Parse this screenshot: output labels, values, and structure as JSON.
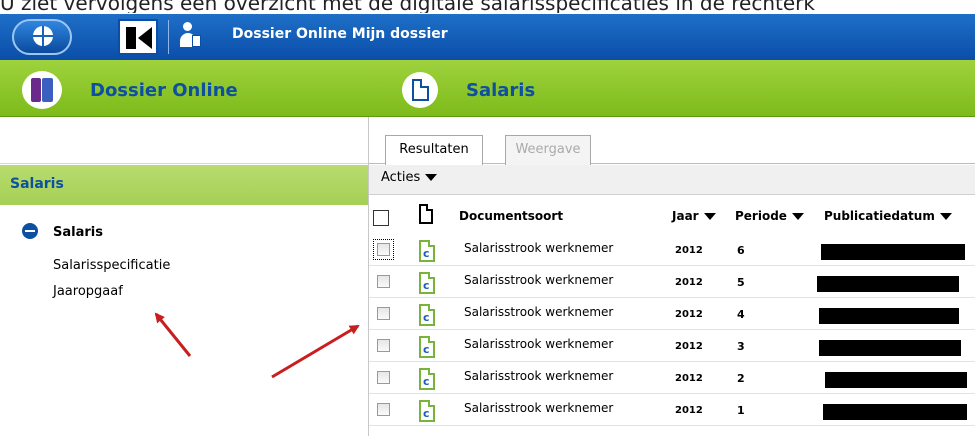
{
  "caption": "U ziet vervolgens een overzicht met de digitale salarisspecificaties in de rechterk",
  "titlebar": {
    "title": "Dossier Online Mijn dossier"
  },
  "header": {
    "app_title": "Dossier Online",
    "section_title": "Salaris"
  },
  "sidebar": {
    "heading": "Salaris",
    "tree_root": "Salaris",
    "items": [
      "Salarisspecificatie",
      "Jaaropgaaf"
    ]
  },
  "tabs": [
    {
      "label": "Resultaten",
      "active": true
    },
    {
      "label": "Weergave",
      "active": false
    }
  ],
  "actions_label": "Acties",
  "table": {
    "columns": [
      "Documentsoort",
      "Jaar",
      "Periode",
      "Publicatiedatum"
    ],
    "doc_icon_letter": "c",
    "rows": [
      {
        "soort": "Salarisstrook werknemer",
        "jaar": "2012",
        "periode": "6"
      },
      {
        "soort": "Salarisstrook werknemer",
        "jaar": "2012",
        "periode": "5"
      },
      {
        "soort": "Salarisstrook werknemer",
        "jaar": "2012",
        "periode": "4"
      },
      {
        "soort": "Salarisstrook werknemer",
        "jaar": "2012",
        "periode": "3"
      },
      {
        "soort": "Salarisstrook werknemer",
        "jaar": "2012",
        "periode": "2"
      },
      {
        "soort": "Salarisstrook werknemer",
        "jaar": "2012",
        "periode": "1"
      }
    ]
  },
  "colors": {
    "title_blue": "#0b4ea8",
    "header_green": "#8cc62a",
    "accent_text": "#0d4fa0",
    "annotation_red": "#c81e1e"
  },
  "icons": [
    "windows-start-icon",
    "back-icon",
    "user-icon",
    "dossier-books-icon",
    "document-icon",
    "collapse-icon",
    "caret-down-icon",
    "doc-c-icon"
  ]
}
